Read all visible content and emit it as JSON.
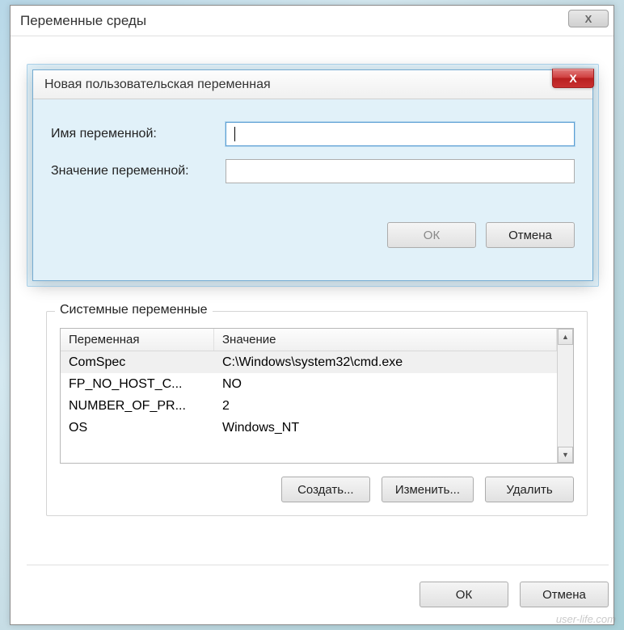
{
  "outer_window": {
    "title": "Переменные среды",
    "close_glyph": "Х"
  },
  "inner_dialog": {
    "title": "Новая пользовательская переменная",
    "close_glyph": "X",
    "labels": {
      "name": "Имя переменной:",
      "value": "Значение переменной:"
    },
    "inputs": {
      "name": "",
      "value": ""
    },
    "buttons": {
      "ok": "ОК",
      "cancel": "Отмена"
    }
  },
  "system_group": {
    "title": "Системные переменные",
    "columns": {
      "var": "Переменная",
      "val": "Значение"
    },
    "rows": [
      {
        "var": "ComSpec",
        "val": "C:\\Windows\\system32\\cmd.exe",
        "selected": true
      },
      {
        "var": "FP_NO_HOST_C...",
        "val": "NO",
        "selected": false
      },
      {
        "var": "NUMBER_OF_PR...",
        "val": "2",
        "selected": false
      },
      {
        "var": "OS",
        "val": "Windows_NT",
        "selected": false
      }
    ],
    "buttons": {
      "create": "Создать...",
      "edit": "Изменить...",
      "delete": "Удалить"
    },
    "scroll": {
      "up": "▲",
      "down": "▼"
    }
  },
  "footer": {
    "ok": "ОК",
    "cancel": "Отмена"
  },
  "watermark": "user-life.com"
}
